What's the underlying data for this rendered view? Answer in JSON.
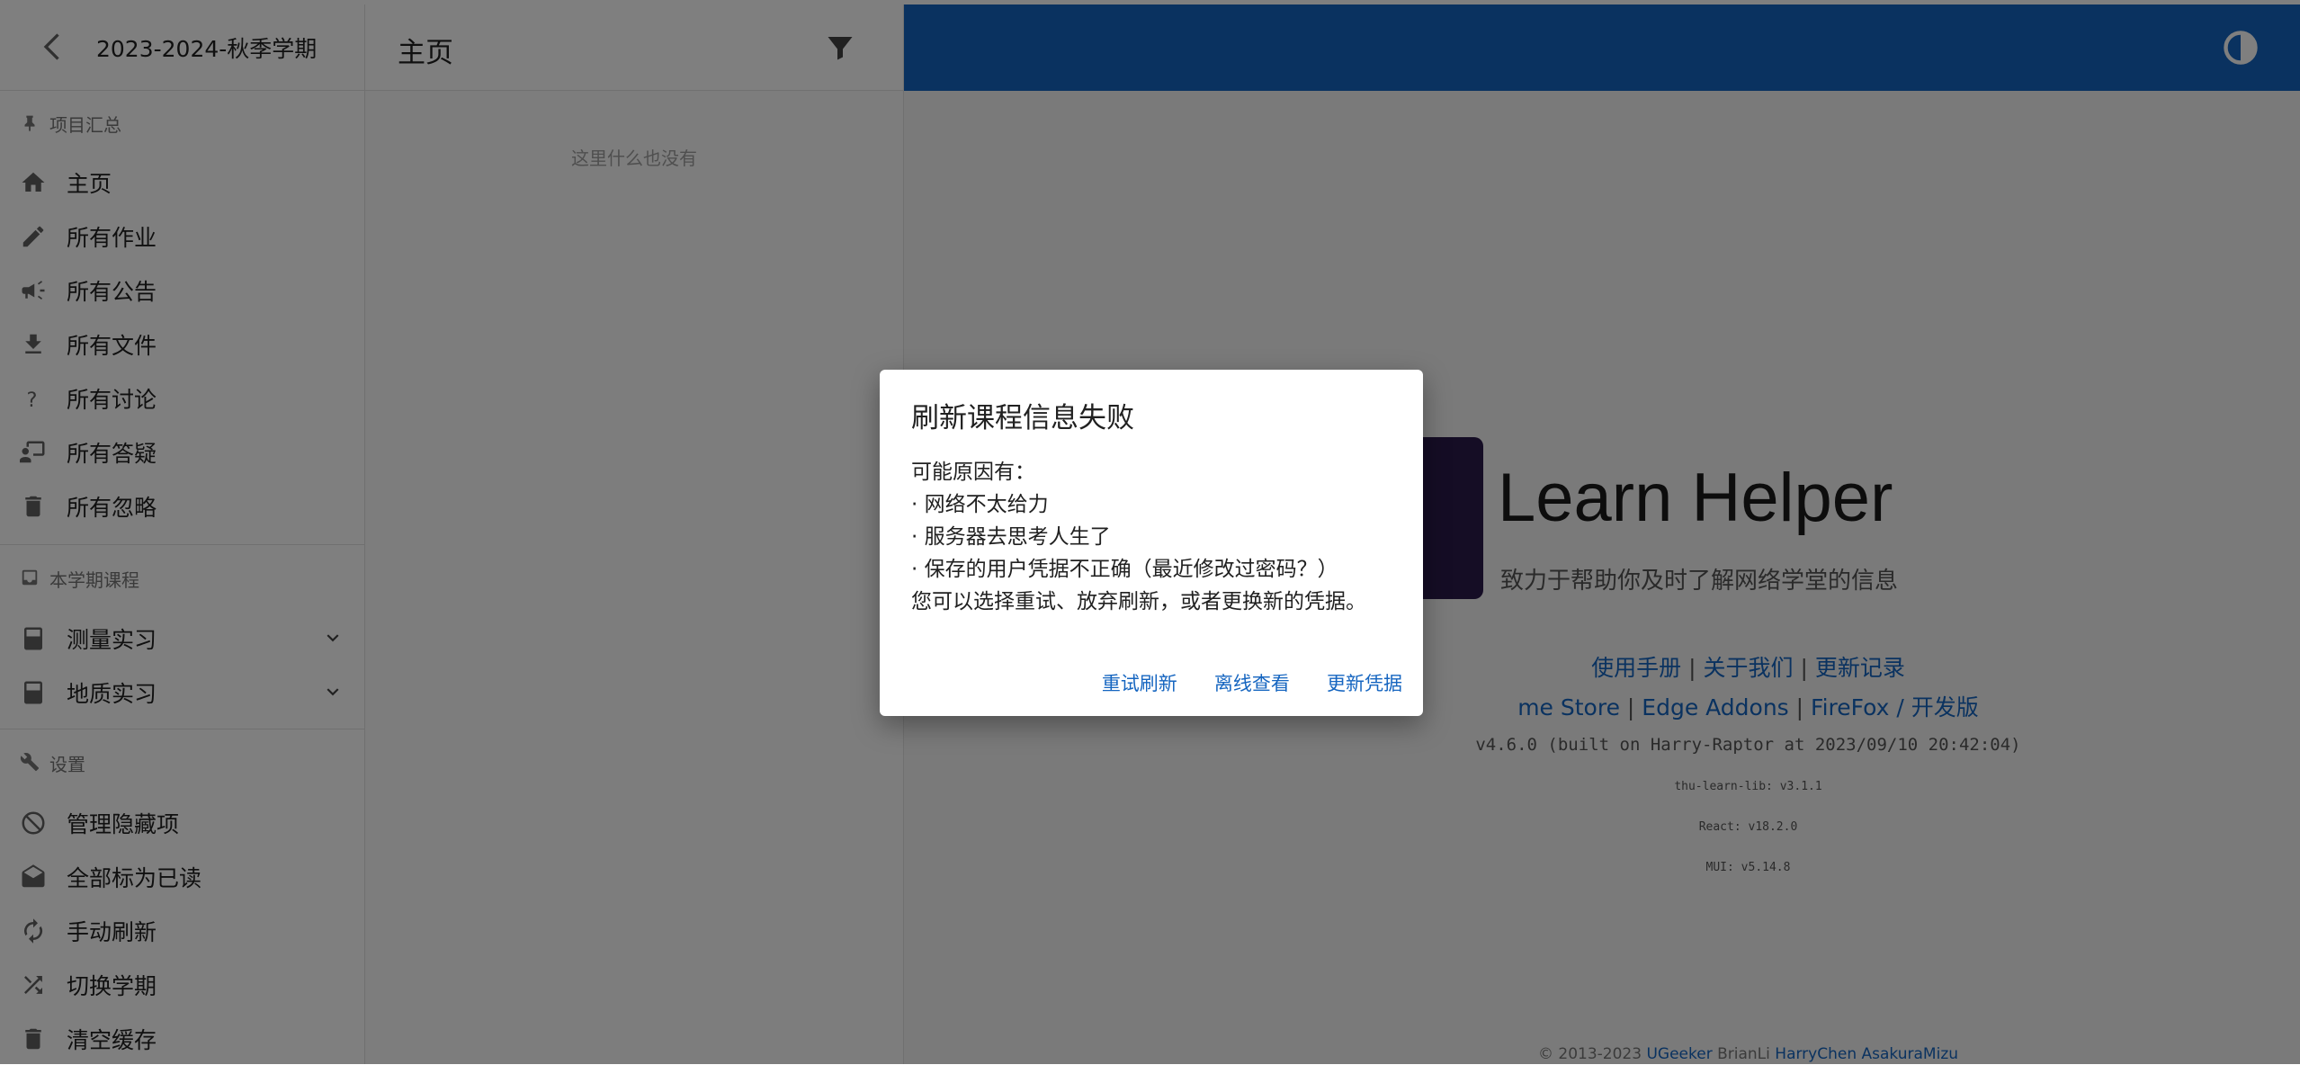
{
  "sidebar": {
    "semester": "2023-2024-秋季学期",
    "section_summary": "项目汇总",
    "items": [
      {
        "label": "主页",
        "icon": "home-icon"
      },
      {
        "label": "所有作业",
        "icon": "pencil-icon"
      },
      {
        "label": "所有公告",
        "icon": "megaphone-icon"
      },
      {
        "label": "所有文件",
        "icon": "download-icon"
      },
      {
        "label": "所有讨论",
        "icon": "question-icon"
      },
      {
        "label": "所有答疑",
        "icon": "presenter-icon"
      },
      {
        "label": "所有忽略",
        "icon": "trash-icon"
      }
    ],
    "section_courses": "本学期课程",
    "courses": [
      {
        "label": "测量实习",
        "icon": "book-icon"
      },
      {
        "label": "地质实习",
        "icon": "book-icon"
      }
    ],
    "section_settings": "设置",
    "settings": [
      {
        "label": "管理隐藏项",
        "icon": "block-icon"
      },
      {
        "label": "全部标为已读",
        "icon": "drafts-icon"
      },
      {
        "label": "手动刷新",
        "icon": "refresh-icon"
      },
      {
        "label": "切换学期",
        "icon": "shuffle-icon"
      },
      {
        "label": "清空缓存",
        "icon": "trash-icon"
      }
    ]
  },
  "middle": {
    "title": "主页",
    "empty_text": "这里什么也没有"
  },
  "right": {
    "brand": "Learn Helper",
    "slogan": "致力于帮助你及时了解网络学堂的信息",
    "links1": [
      "使用手册",
      "关于我们",
      "更新记录"
    ],
    "links2_prefix": "me Store",
    "links2": [
      "Edge Addons",
      "FireFox / 开发版"
    ],
    "version": "v4.6.0 (built on Harry-Raptor at 2023/09/10 20:42:04)",
    "lib": "thu-learn-lib: v3.1.1",
    "react": "React: v18.2.0",
    "mui": "MUI: v5.14.8",
    "footer_prefix": "© 2013-2023",
    "footer_link1": "UGeeker",
    "footer_plain": "BrianLi",
    "footer_link2": "HarryChen",
    "footer_link3": "AsakuraMizu"
  },
  "dialog": {
    "title": "刷新课程信息失败",
    "line1": "可能原因有：",
    "line2": "· 网络不太给力",
    "line3": "· 服务器去思考人生了",
    "line4": "· 保存的用户凭据不正确（最近修改过密码？）",
    "line5": "您可以选择重试、放弃刷新，或者更换新的凭据。",
    "btn_retry": "重试刷新",
    "btn_offline": "离线查看",
    "btn_update": "更新凭据"
  },
  "colors": {
    "appbar": "#1565c0",
    "link": "#1565c0",
    "logo": "#2a1a4a"
  }
}
